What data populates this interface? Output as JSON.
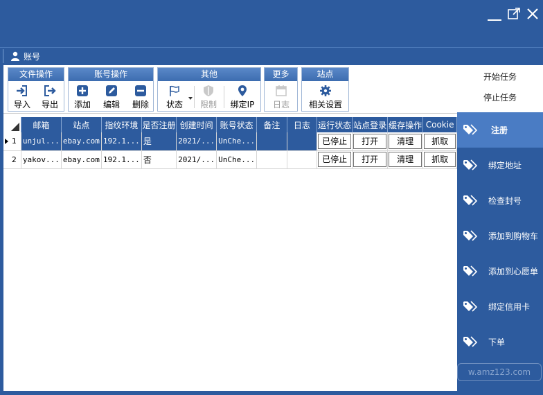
{
  "window": {
    "minimize": "—",
    "maximize": "⧉",
    "close": "✕"
  },
  "account_tab": {
    "label": "账号"
  },
  "toolbar": {
    "groups": [
      {
        "title": "文件操作",
        "buttons": [
          {
            "label": "导入",
            "icon": "import-icon"
          },
          {
            "label": "导出",
            "icon": "export-icon"
          }
        ]
      },
      {
        "title": "账号操作",
        "buttons": [
          {
            "label": "添加",
            "icon": "add-icon"
          },
          {
            "label": "编辑",
            "icon": "edit-icon"
          },
          {
            "label": "删除",
            "icon": "delete-icon"
          }
        ]
      },
      {
        "title": "其他",
        "buttons": [
          {
            "label": "状态",
            "icon": "flag-icon"
          },
          {
            "label": "限制",
            "icon": "shield-icon",
            "disabled": true
          },
          {
            "label": "绑定IP",
            "icon": "location-pin-icon"
          }
        ]
      },
      {
        "title": "更多",
        "buttons": [
          {
            "label": "日志",
            "icon": "calendar-icon",
            "disabled": true
          }
        ]
      },
      {
        "title": "站点",
        "buttons": [
          {
            "label": "相关设置",
            "icon": "gear-icon"
          }
        ]
      }
    ]
  },
  "grid": {
    "columns": [
      "邮箱",
      "站点",
      "指纹环境",
      "是否注册",
      "创建时间",
      "账号状态",
      "备注",
      "日志",
      "运行状态",
      "站点登录",
      "缓存操作",
      "Cookie"
    ],
    "rows": [
      {
        "index": "1",
        "email": "unjul...",
        "site": "ebay.com",
        "fingerprint": "192.1...",
        "registered": "是",
        "created": "2021/...",
        "status": "UnChe...",
        "note": "",
        "log": "",
        "run": "已停止",
        "login": "打开",
        "cache": "清理",
        "cookie": "抓取"
      },
      {
        "index": "2",
        "email": "yakov...",
        "site": "ebay.com",
        "fingerprint": "192.1...",
        "registered": "否",
        "created": "2021/...",
        "status": "UnChe...",
        "note": "",
        "log": "",
        "run": "已停止",
        "login": "打开",
        "cache": "清理",
        "cookie": "抓取"
      }
    ]
  },
  "side": {
    "start_task": "开始任务",
    "stop_task": "停止任务",
    "nav": [
      "注册",
      "绑定地址",
      "检查封号",
      "添加到购物车",
      "添加到心愿单",
      "绑定信用卡",
      "下单"
    ],
    "active": "注册",
    "watermark": "w.amz123.com"
  },
  "colors": {
    "primary": "#2d5b9e",
    "active_nav": "#4a7cc4",
    "header_gradient_top": "#5a88c8"
  }
}
